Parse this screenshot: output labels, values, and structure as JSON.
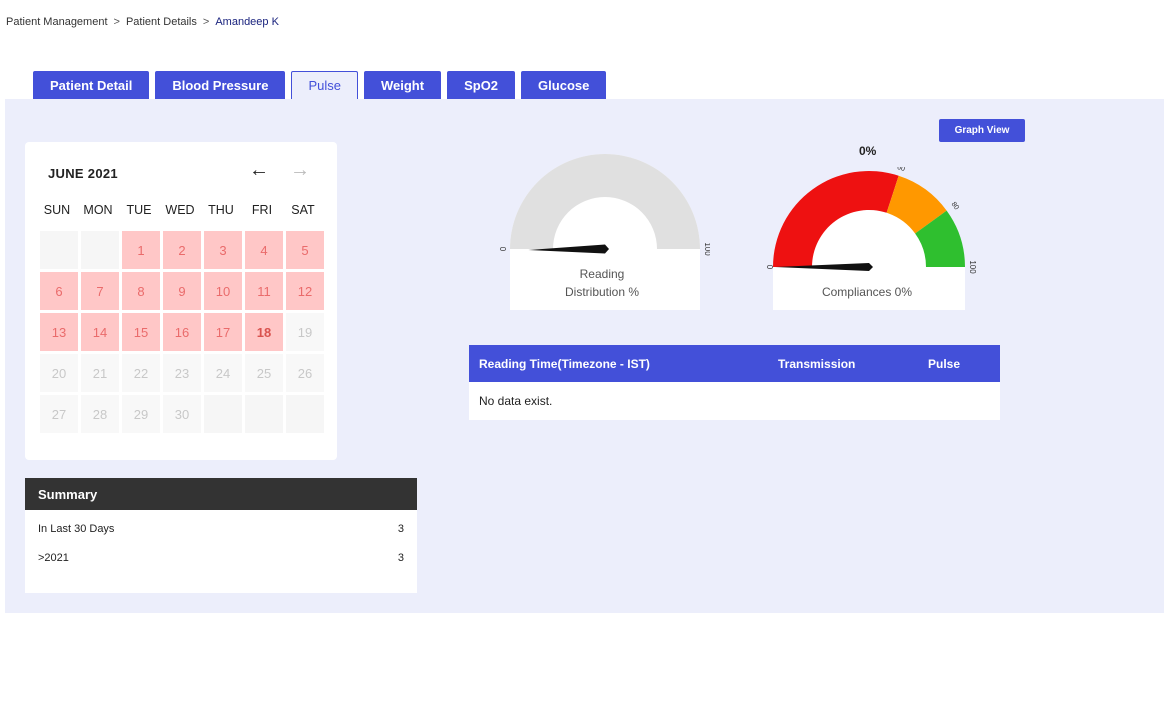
{
  "breadcrumb": {
    "items": [
      "Patient Management",
      "Patient Details",
      "Amandeep K"
    ],
    "separator": ">"
  },
  "tabs": [
    {
      "label": "Patient Detail",
      "active": false
    },
    {
      "label": "Blood Pressure",
      "active": false
    },
    {
      "label": "Pulse",
      "active": true
    },
    {
      "label": "Weight",
      "active": false
    },
    {
      "label": "SpO2",
      "active": false
    },
    {
      "label": "Glucose",
      "active": false
    }
  ],
  "graph_view_button": "Graph View",
  "calendar": {
    "title": "JUNE 2021",
    "prev_icon": "←",
    "next_icon": "→",
    "weekdays": [
      "SUN",
      "MON",
      "TUE",
      "WED",
      "THU",
      "FRI",
      "SAT"
    ],
    "leading_blanks": 2,
    "days_in_month": 30,
    "reading_days": [
      1,
      2,
      3,
      4,
      5,
      6,
      7,
      8,
      9,
      10,
      11,
      12,
      13,
      14,
      15,
      16,
      17,
      18
    ],
    "today": 18,
    "colors": {
      "reading_bg": "#ffc7c7",
      "reading_text": "#ea6b6b",
      "future_text": "#c8c8c8"
    }
  },
  "summary": {
    "title": "Summary",
    "rows": [
      {
        "label": "In Last 30 Days",
        "value": "3"
      },
      {
        "label": ">2021",
        "value": "3"
      }
    ]
  },
  "gauges": {
    "distribution": {
      "label_line1": "Reading",
      "label_line2": "Distribution %",
      "min_label": "0",
      "max_label": "100",
      "needle_value": 0
    },
    "compliance": {
      "value_text": "0%",
      "label": "Compliances 0%",
      "min_label": "0",
      "max_label": "100",
      "tick_60": "60",
      "tick_80": "80",
      "needle_value": 0,
      "bands": [
        {
          "from": 0,
          "to": 60,
          "color": "#ee1111"
        },
        {
          "from": 60,
          "to": 80,
          "color": "#ff9800"
        },
        {
          "from": 80,
          "to": 100,
          "color": "#2fbf2f"
        }
      ]
    }
  },
  "table": {
    "headers": [
      "Reading Time(Timezone - IST)",
      "Transmission",
      "Pulse"
    ],
    "empty_message": "No data exist."
  },
  "colors": {
    "primary": "#4350d9",
    "panel_bg": "#eceefb",
    "summary_head": "#333333"
  }
}
